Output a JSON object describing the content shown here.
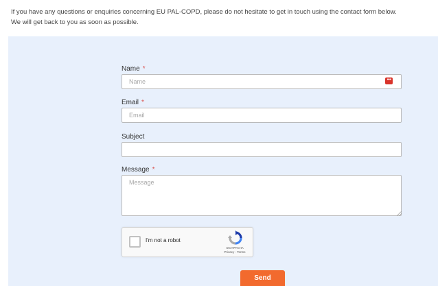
{
  "intro": {
    "line1": "If you have any questions or enquiries concerning EU PAL-COPD, please do not hesitate to get in touch using the contact form below.",
    "line2": "We will get back to you as soon as possible."
  },
  "form": {
    "required_mark": "*",
    "name": {
      "label": "Name",
      "placeholder": "Name",
      "value": ""
    },
    "email": {
      "label": "Email",
      "placeholder": "Email",
      "value": ""
    },
    "subject": {
      "label": "Subject",
      "placeholder": "",
      "value": ""
    },
    "message": {
      "label": "Message",
      "placeholder": "Message",
      "value": ""
    },
    "send_label": "Send"
  },
  "recaptcha": {
    "label": "I'm not a robot",
    "brand": "reCAPTCHA",
    "links": "Privacy - Terms",
    "icon": "recaptcha-logo-icon"
  },
  "icons": {
    "password_manager": "password-manager-icon",
    "password_manager_glyph": "•••"
  },
  "colors": {
    "form_background": "#e8f0fc",
    "accent": "#f26a2e",
    "required": "#d9534f"
  }
}
